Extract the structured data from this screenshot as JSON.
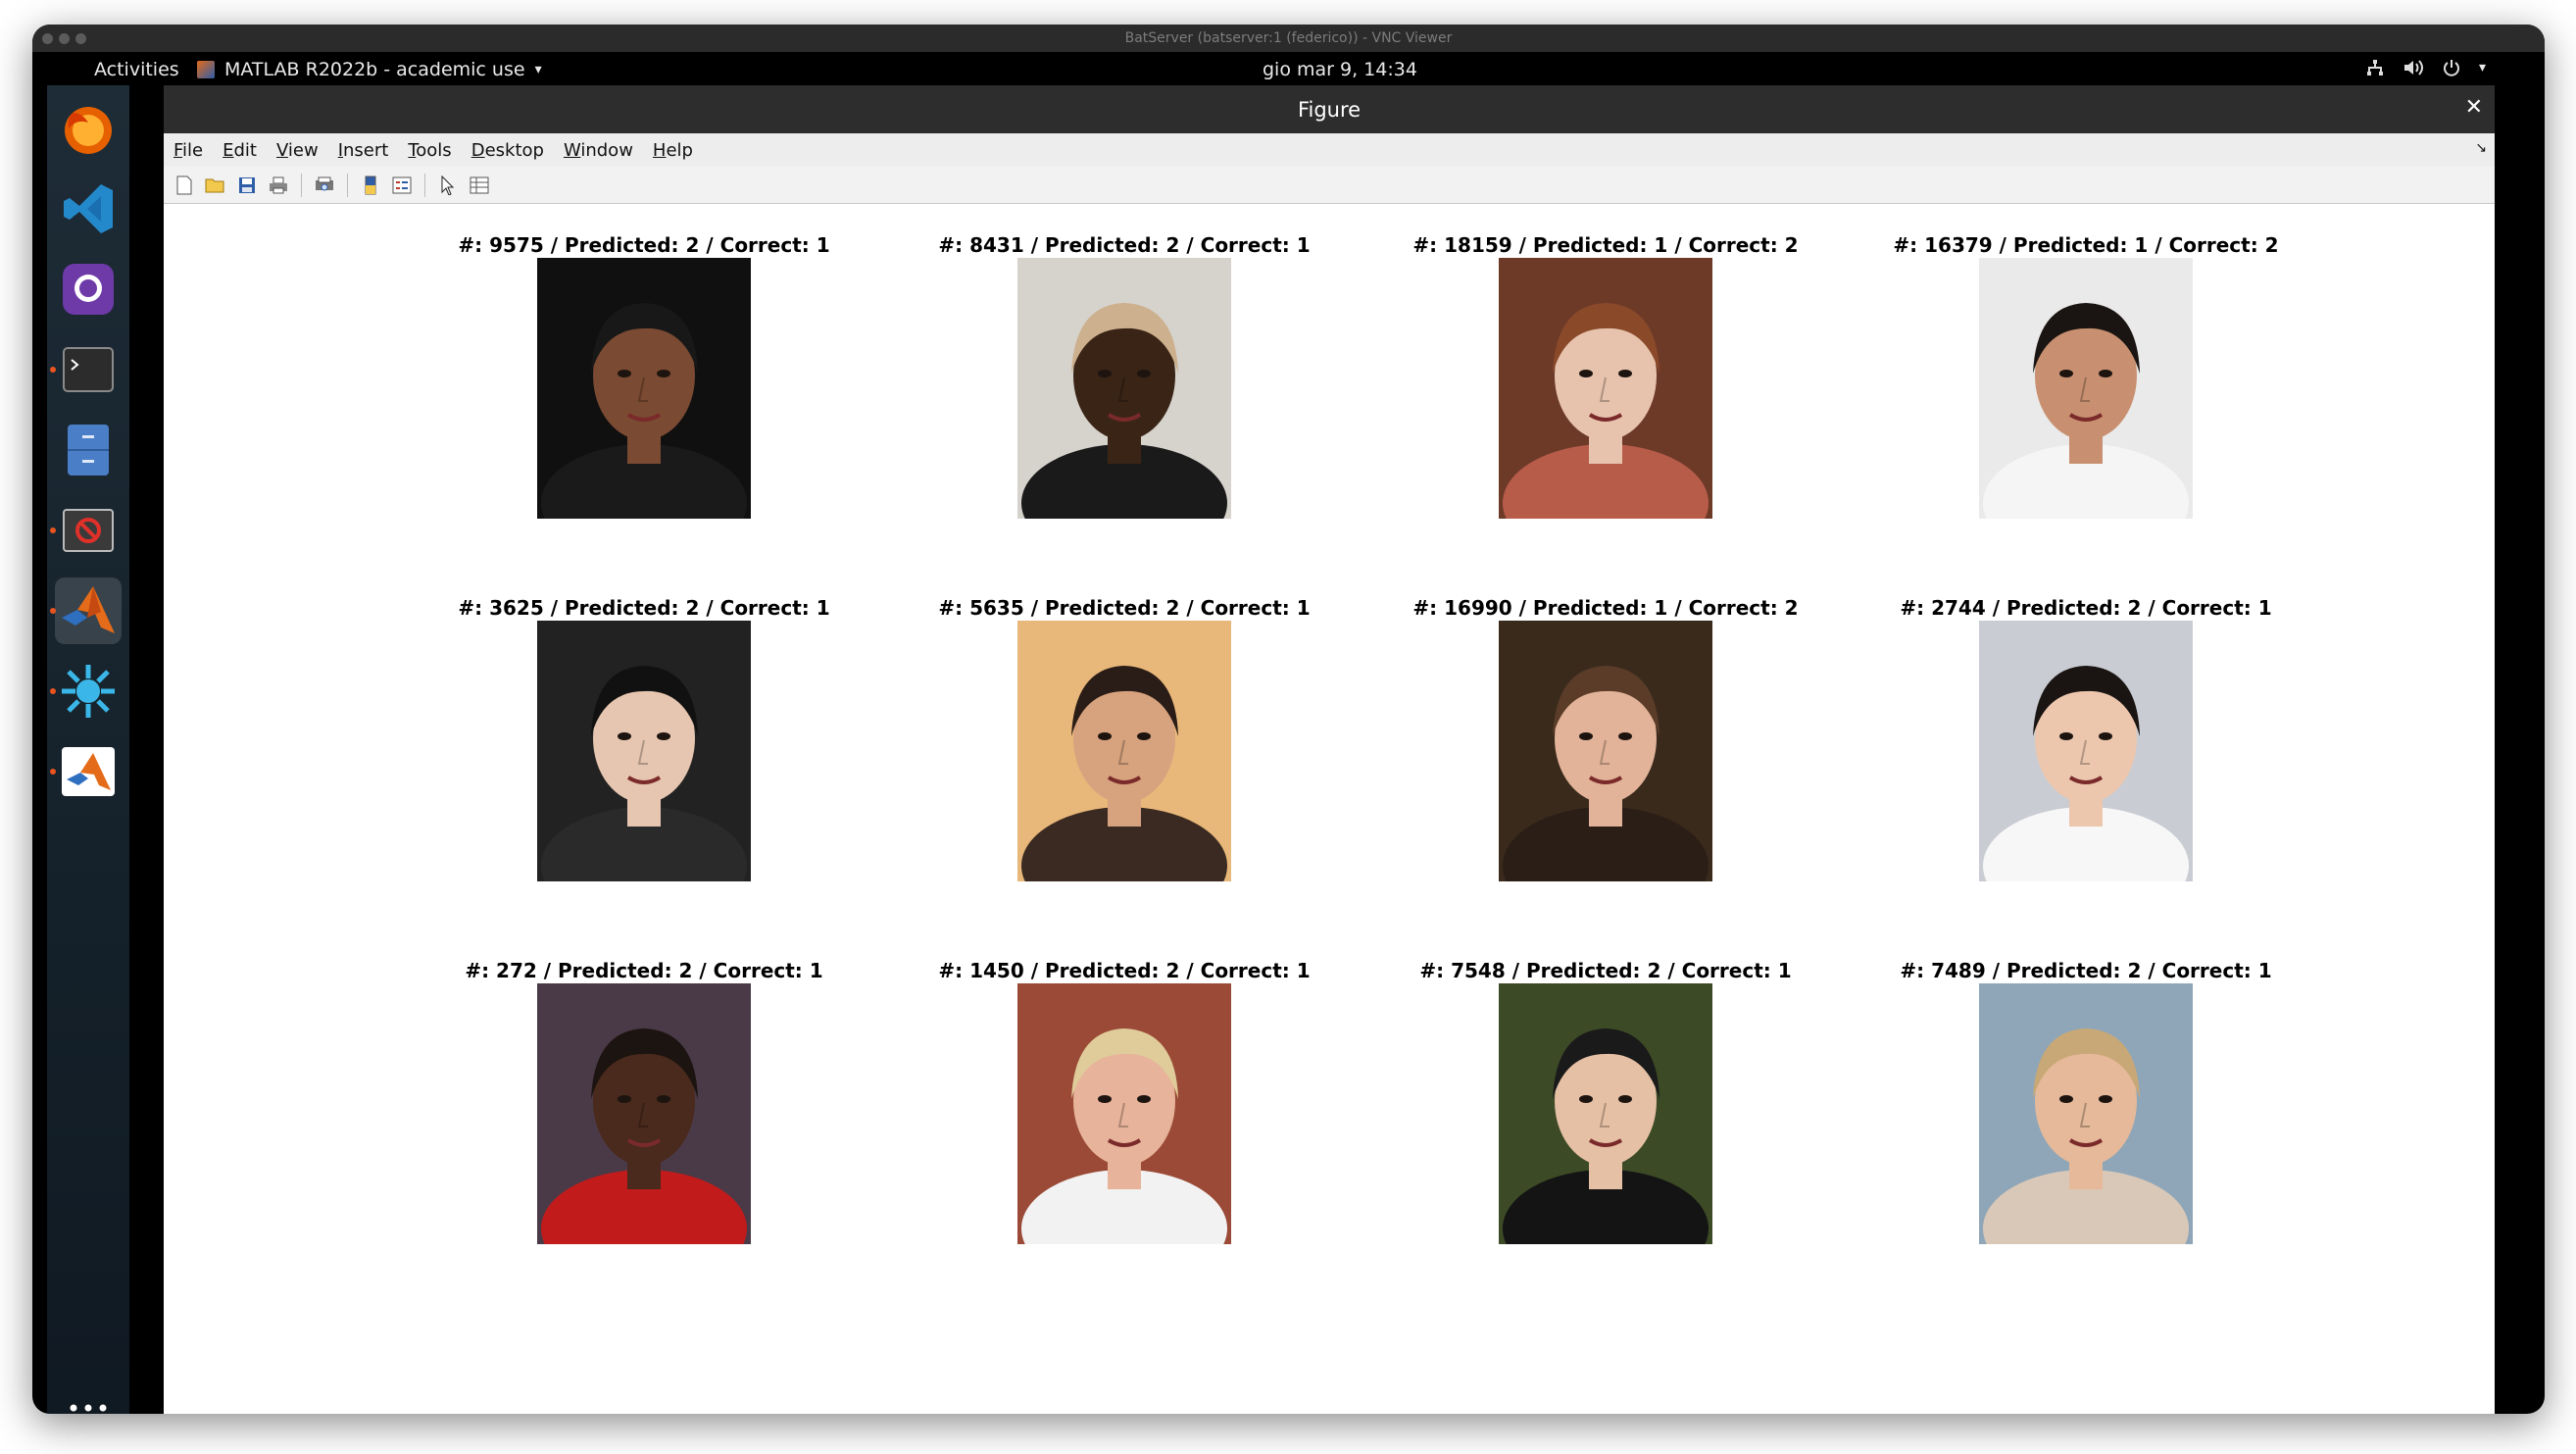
{
  "vnc": {
    "title": "BatServer (batserver:1 (federico)) - VNC Viewer"
  },
  "topbar": {
    "activities": "Activities",
    "app_menu": "MATLAB R2022b - academic use",
    "clock": "gio mar  9, 14:34"
  },
  "dock": {
    "items": [
      "firefox-icon",
      "vscode-icon",
      "github-desktop-icon",
      "terminal-icon",
      "file-manager-icon",
      "blocked-app-icon",
      "matlab-icon",
      "splash-app-icon",
      "matlab-alt-icon",
      "show-apps-grid-icon"
    ]
  },
  "figure": {
    "title": "Figure",
    "close": "✕",
    "menu": [
      "File",
      "Edit",
      "View",
      "Insert",
      "Tools",
      "Desktop",
      "Window",
      "Help"
    ],
    "menu_arrow": "↘",
    "toolbar": [
      "new-figure-icon",
      "open-file-icon",
      "save-icon",
      "print-icon",
      "print-preview-icon",
      "colorbar-icon",
      "legend-icon",
      "pointer-icon",
      "property-inspector-icon"
    ]
  },
  "subplots": [
    {
      "title": "#: 9575 / Predicted: 2 / Correct: 1",
      "bg": "#101010",
      "skin": "#7a4a32",
      "hair": "#181818",
      "shirt": "#1a1a1a"
    },
    {
      "title": "#: 8431 / Predicted: 2 / Correct: 1",
      "bg": "#d6d2cc",
      "skin": "#3a2416",
      "hair": "#cdb08d",
      "shirt": "#1a1a1a"
    },
    {
      "title": "#: 18159 / Predicted: 1 / Correct: 2",
      "bg": "#6e3a28",
      "skin": "#e7c3ad",
      "hair": "#8a4a2a",
      "shirt": "#b85c4a"
    },
    {
      "title": "#: 16379 / Predicted: 1 / Correct: 2",
      "bg": "#eaeaea",
      "skin": "#c89070",
      "hair": "#1a1412",
      "shirt": "#f5f5f5"
    },
    {
      "title": "#: 3625 / Predicted: 2 / Correct: 1",
      "bg": "#222222",
      "skin": "#e6c6b0",
      "hair": "#111111",
      "shirt": "#2a2a2a"
    },
    {
      "title": "#: 5635 / Predicted: 2 / Correct: 1",
      "bg": "#e8b77a",
      "skin": "#d7a27e",
      "hair": "#2a1c16",
      "shirt": "#3a2a22"
    },
    {
      "title": "#: 16990 / Predicted: 1 / Correct: 2",
      "bg": "#3a2a1c",
      "skin": "#e2b398",
      "hair": "#5a3c28",
      "shirt": "#2a1e16"
    },
    {
      "title": "#: 2744 / Predicted: 2 / Correct: 1",
      "bg": "#c9ccd2",
      "skin": "#ecc7ae",
      "hair": "#1a1412",
      "shirt": "#f7f7f7"
    },
    {
      "title": "#: 272 / Predicted: 2 / Correct: 1",
      "bg": "#4a3a48",
      "skin": "#4a2a1c",
      "hair": "#1c1410",
      "shirt": "#c11b1b"
    },
    {
      "title": "#: 1450 / Predicted: 2 / Correct: 1",
      "bg": "#9a4a36",
      "skin": "#e7b39a",
      "hair": "#e0cc9a",
      "shirt": "#f2f2f2"
    },
    {
      "title": "#: 7548 / Predicted: 2 / Correct: 1",
      "bg": "#3c4a26",
      "skin": "#e6c0a4",
      "hair": "#1a1a1a",
      "shirt": "#141414"
    },
    {
      "title": "#: 7489 / Predicted: 2 / Correct: 1",
      "bg": "#8fa6b8",
      "skin": "#e5b99a",
      "hair": "#c9a877",
      "shirt": "#d9c8b8"
    }
  ]
}
